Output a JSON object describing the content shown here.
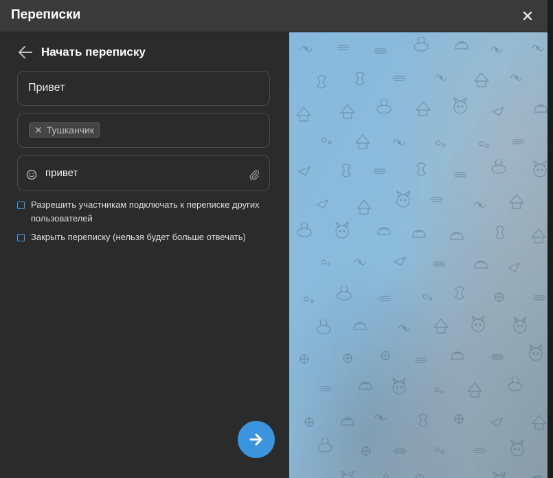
{
  "window": {
    "title": "Переписки"
  },
  "panel": {
    "title": "Начать переписку"
  },
  "subject": {
    "value": "Привет"
  },
  "recipients": [
    {
      "name": "Тушканчик"
    }
  ],
  "message": {
    "value": "привет"
  },
  "options": [
    {
      "label": "Разрешить участникам подключать к переписке других пользователей",
      "checked": false
    },
    {
      "label": "Закрыть переписку (нельзя будет больше отвечать)",
      "checked": false
    }
  ],
  "icons": {
    "close": "close-icon",
    "back": "arrow-left-icon",
    "chip_remove": "x-icon",
    "emoji": "smiley-icon",
    "attach": "paperclip-icon",
    "send": "arrow-right-icon"
  },
  "colors": {
    "accent": "#3b94de",
    "checkbox": "#4a9ce6",
    "background": "#2b2b2b",
    "titlebar": "#3a3a3a",
    "wallpaper_light": "#8fbfe0",
    "wallpaper_dark": "#7c95a8"
  }
}
